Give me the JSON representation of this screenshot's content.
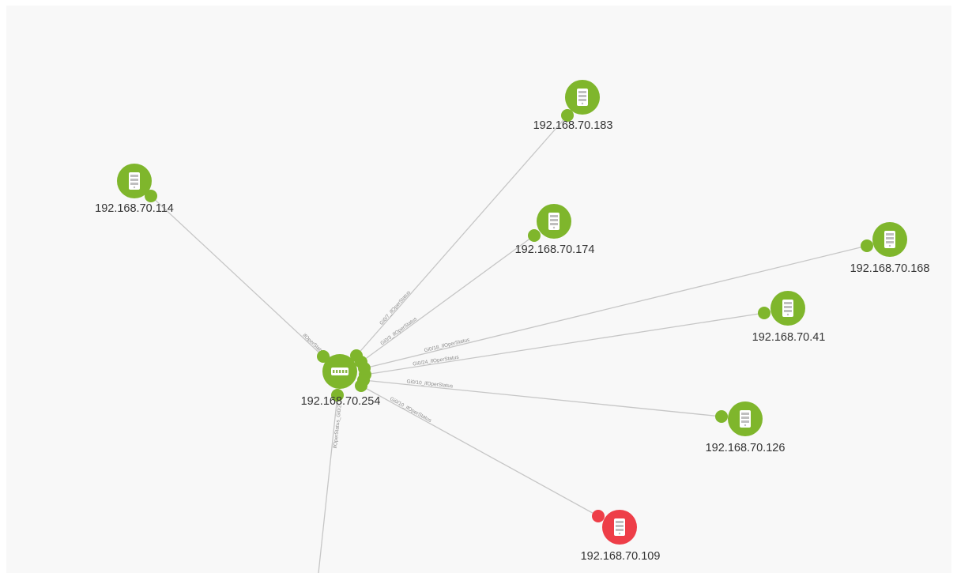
{
  "colors": {
    "ok": "#7fb62c",
    "down": "#ee3e48",
    "link": "#c6c6c6",
    "background": "#f8f8f8"
  },
  "hub": {
    "ip": "192.168.70.254",
    "icon": "switch-icon",
    "status": "ok"
  },
  "nodes": [
    {
      "ip": "192.168.70.183",
      "icon": "server-icon",
      "status": "ok",
      "link_label": "Gi0/7_ifOperStatus"
    },
    {
      "ip": "192.168.70.114",
      "icon": "server-icon",
      "status": "ok",
      "link_label": "ifOperStatus_Gi0/5"
    },
    {
      "ip": "192.168.70.174",
      "icon": "server-icon",
      "status": "ok",
      "link_label": "Gi0/3_ifOperStatus"
    },
    {
      "ip": "192.168.70.168",
      "icon": "server-icon",
      "status": "ok",
      "link_label": "Gi0/18_ifOperStatus"
    },
    {
      "ip": "192.168.70.41",
      "icon": "server-icon",
      "status": "ok",
      "link_label": "Gi0/24_ifOperStatus"
    },
    {
      "ip": "192.168.70.126",
      "icon": "server-icon",
      "status": "ok",
      "link_label": "Gi0/10_ifOperStatus"
    },
    {
      "ip": "192.168.70.109",
      "icon": "server-icon",
      "status": "down",
      "link_label": "Gi0/10_ifOperStatus"
    }
  ],
  "offscreen_link": {
    "link_label": "ifOperStatus_Gi0/2"
  }
}
